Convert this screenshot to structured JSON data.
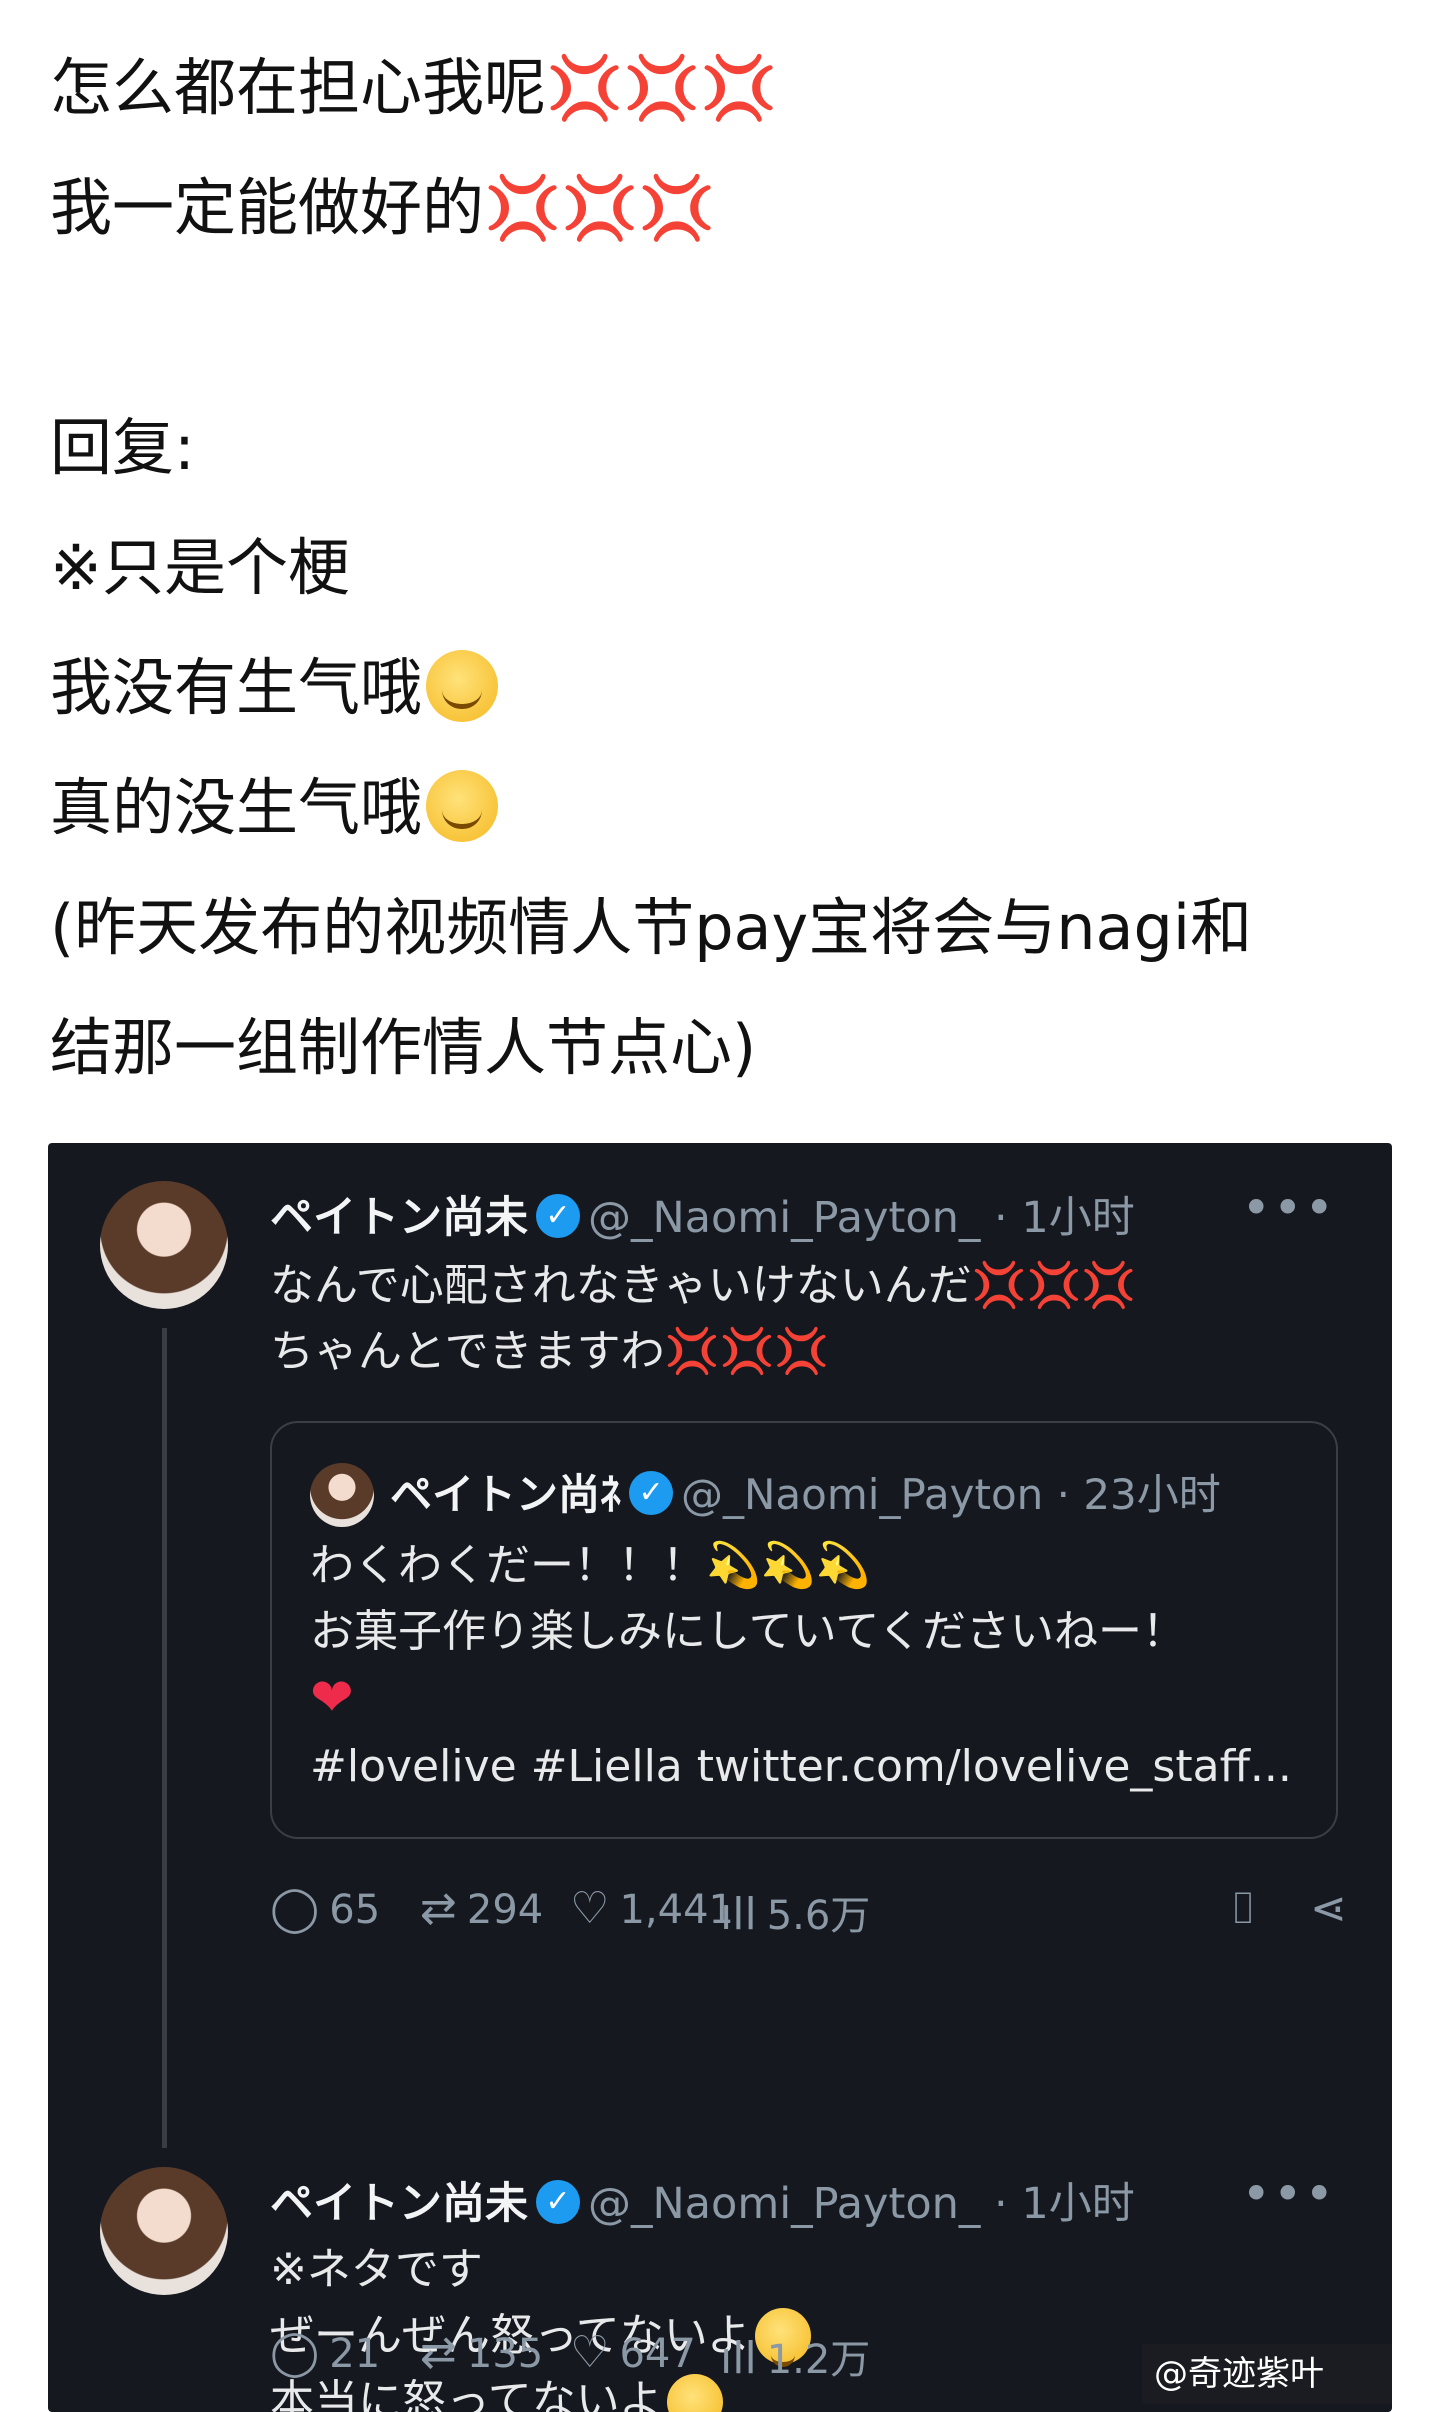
{
  "post": {
    "lines": [
      "怎么都在担心我呢",
      "我一定能做好的",
      "",
      "回复:",
      "※只是个梗",
      "我没有生气哦",
      "真的没生气哦",
      "(昨天发布的视频情人节pay宝将会与nagi和",
      "结那一组制作情人节点心)"
    ],
    "anger_emoji": "💢💢💢"
  },
  "tweet1": {
    "name": "ペイトン尚未",
    "handle": "@_Naomi_Payton_",
    "time": "· 1小时",
    "more": "•••",
    "line1": "なんで心配されなきゃいけないんだ",
    "line2": "ちゃんとできますわ",
    "anger": "💢💢💢"
  },
  "quote": {
    "name": "ペイトン尚ﾈ",
    "handle": "@_Naomi_Payton",
    "time": "· 23小时",
    "line1": "わくわくだー！！！",
    "sparkles": "💫💫💫",
    "line2": "お菓子作り楽しみにしていてくださいねー！",
    "heart": "❤",
    "line4": "#lovelive #Liella twitter.com/lovelive_staff..."
  },
  "actions1": {
    "reply": "65",
    "retweet": "294",
    "like": "1,441",
    "views": "5.6万"
  },
  "tweet2": {
    "name": "ペイトン尚未",
    "handle": "@_Naomi_Payton_",
    "time": "· 1小时",
    "more": "•••",
    "line1": "※ネタです",
    "line2": "ぜーんぜん怒ってないよ",
    "line3": "本当に怒ってないよ"
  },
  "actions2": {
    "reply": "21",
    "retweet": "135",
    "like": "647",
    "views": "1.2万"
  },
  "icons": {
    "reply": "💬",
    "retweet": "⇄",
    "like": "♡",
    "views": "📊",
    "bookmark": "🔖",
    "share": "share-icon"
  },
  "watermark": "@奇迹紫叶"
}
